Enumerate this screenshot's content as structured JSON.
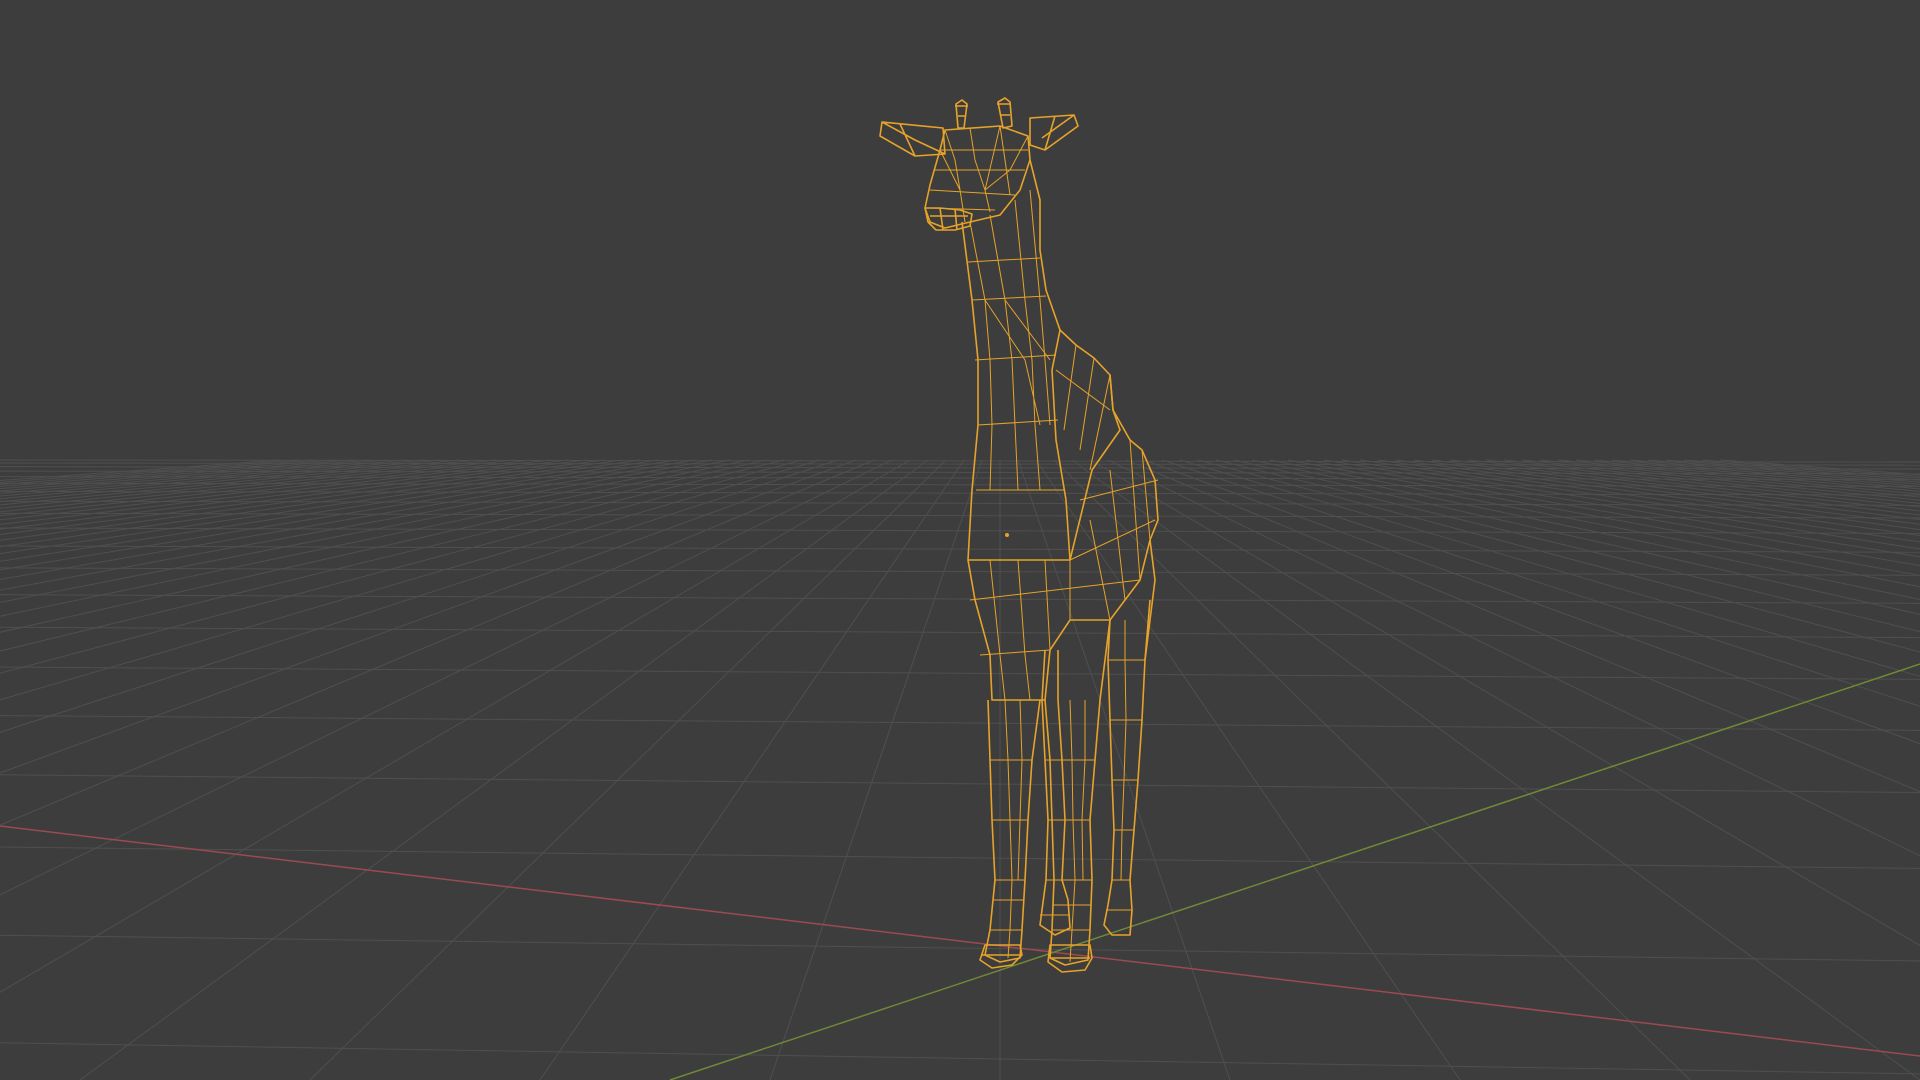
{
  "viewport": {
    "background_color": "#3d3d3d",
    "grid_color": "#555555",
    "x_axis_color": "#9b4a52",
    "y_axis_color": "#6e8a36",
    "wireframe_color": "#e6a32a",
    "selected_object": "giraffe-mesh",
    "display_mode": "wireframe"
  }
}
